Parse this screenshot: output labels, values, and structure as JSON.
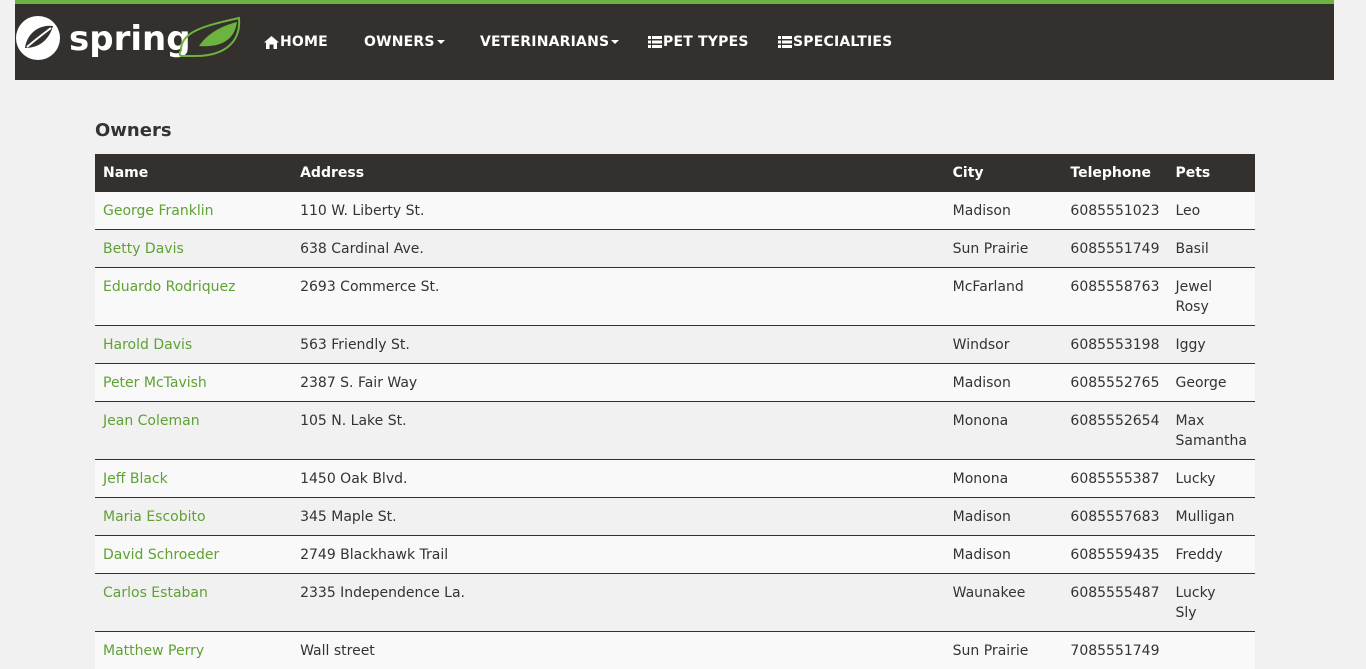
{
  "brand": {
    "name": "spring",
    "logo": "spring-leaf-logo",
    "colors": {
      "accent": "#6db33f",
      "nav_bg": "#34302d",
      "link": "#5fa134"
    }
  },
  "nav": {
    "home": {
      "label": "HOME",
      "icon": "home-icon"
    },
    "owners": {
      "label": "OWNERS"
    },
    "veterinarians": {
      "label": "VETERINARIANS"
    },
    "pet_types": {
      "label": "PET TYPES",
      "icon": "th-list-icon"
    },
    "specialties": {
      "label": "SPECIALTIES",
      "icon": "th-list-icon"
    }
  },
  "page": {
    "title": "Owners"
  },
  "table": {
    "headers": [
      "Name",
      "Address",
      "City",
      "Telephone",
      "Pets"
    ],
    "rows": [
      {
        "name": "George Franklin",
        "address": "110 W. Liberty St.",
        "city": "Madison",
        "telephone": "6085551023",
        "pets": [
          "Leo"
        ]
      },
      {
        "name": "Betty Davis",
        "address": "638 Cardinal Ave.",
        "city": "Sun Prairie",
        "telephone": "6085551749",
        "pets": [
          "Basil"
        ]
      },
      {
        "name": "Eduardo Rodriquez",
        "address": "2693 Commerce St.",
        "city": "McFarland",
        "telephone": "6085558763",
        "pets": [
          "Jewel",
          "Rosy"
        ]
      },
      {
        "name": "Harold Davis",
        "address": "563 Friendly St.",
        "city": "Windsor",
        "telephone": "6085553198",
        "pets": [
          "Iggy"
        ]
      },
      {
        "name": "Peter McTavish",
        "address": "2387 S. Fair Way",
        "city": "Madison",
        "telephone": "6085552765",
        "pets": [
          "George"
        ]
      },
      {
        "name": "Jean Coleman",
        "address": "105 N. Lake St.",
        "city": "Monona",
        "telephone": "6085552654",
        "pets": [
          "Max",
          "Samantha"
        ]
      },
      {
        "name": "Jeff Black",
        "address": "1450 Oak Blvd.",
        "city": "Monona",
        "telephone": "6085555387",
        "pets": [
          "Lucky"
        ]
      },
      {
        "name": "Maria Escobito",
        "address": "345 Maple St.",
        "city": "Madison",
        "telephone": "6085557683",
        "pets": [
          "Mulligan"
        ]
      },
      {
        "name": "David Schroeder",
        "address": "2749 Blackhawk Trail",
        "city": "Madison",
        "telephone": "6085559435",
        "pets": [
          "Freddy"
        ]
      },
      {
        "name": "Carlos Estaban",
        "address": "2335 Independence La.",
        "city": "Waunakee",
        "telephone": "6085555487",
        "pets": [
          "Lucky",
          "Sly"
        ]
      },
      {
        "name": "Matthew Perry",
        "address": "Wall street",
        "city": "Sun Prairie",
        "telephone": "7085551749",
        "pets": []
      }
    ]
  }
}
